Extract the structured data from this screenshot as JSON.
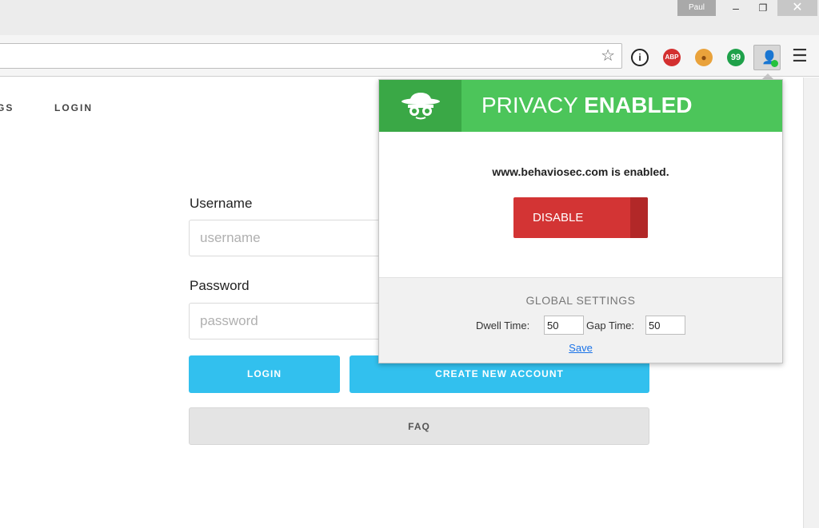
{
  "window": {
    "profile_name": "Paul",
    "minimize": "–",
    "maximize": "❐",
    "close": "✕"
  },
  "toolbar": {
    "extensions": [
      {
        "name": "info",
        "glyph": "i"
      },
      {
        "name": "adblock",
        "glyph": "ABP"
      },
      {
        "name": "cookie",
        "glyph": "●"
      },
      {
        "name": "hangouts",
        "glyph": "99"
      }
    ]
  },
  "page": {
    "nav": {
      "settings": "GS",
      "login": "LOGIN"
    },
    "form": {
      "username_label": "Username",
      "username_placeholder": "username",
      "password_label": "Password",
      "password_placeholder": "password",
      "login_button": "LOGIN",
      "create_button": "CREATE NEW ACCOUNT",
      "faq_button": "FAQ"
    }
  },
  "popup": {
    "title_light": "PRIVACY ",
    "title_bold": "ENABLED",
    "site_status": "www.behaviosec.com is enabled.",
    "disable_button": "DISABLE",
    "global_settings_title": "GLOBAL SETTINGS",
    "dwell_label": "Dwell Time:",
    "dwell_value": "50",
    "gap_label": "Gap Time:",
    "gap_value": "50",
    "save_link": "Save"
  },
  "colors": {
    "header_green": "#4cc55a",
    "accent_blue": "#32c0ee",
    "disable_red": "#d33434"
  }
}
